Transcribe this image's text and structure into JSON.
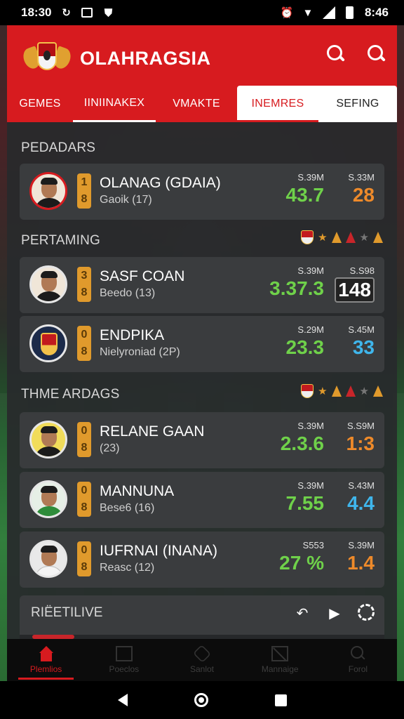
{
  "status_bar": {
    "time_left": "18:30",
    "time_right": "8:46"
  },
  "header": {
    "title": "OLAHRAGSIA",
    "icons": [
      "search-icon",
      "search-icon"
    ]
  },
  "tabs": [
    {
      "label": "GEMES"
    },
    {
      "label": "IINIINAKEX"
    },
    {
      "label": "VMAKTE"
    },
    {
      "label": "INEMRES"
    },
    {
      "label": "SEFING"
    }
  ],
  "sections": [
    {
      "title": "PEDADARS",
      "players": [
        {
          "name": "OLANAG (GDAIA)",
          "sub": "Gaoik (17)",
          "rank_top": "1",
          "rank_bottom": "8",
          "stat1_label": "S.39M",
          "stat1_value": "43.7",
          "stat2_label": "S.33M",
          "stat2_value": "28"
        }
      ]
    },
    {
      "title": "PERTAMING",
      "players": [
        {
          "name": "SASF COAN",
          "sub": "Beedo (13)",
          "rank_top": "3",
          "rank_bottom": "8",
          "stat1_label": "S.39M",
          "stat1_value": "3.37.3",
          "stat2_label": "S.S98",
          "stat2_value": "148"
        },
        {
          "name": "ENDPIKA",
          "sub": "Nielyroniad (2P)",
          "rank_top": "0",
          "rank_bottom": "8",
          "stat1_label": "S.29M",
          "stat1_value": "23.3",
          "stat2_label": "S.45M",
          "stat2_value": "33"
        }
      ]
    },
    {
      "title": "THME ARDAGS",
      "players": [
        {
          "name": "RELANE GAAN",
          "sub": "(23)",
          "rank_top": "0",
          "rank_bottom": "8",
          "stat1_label": "S.39M",
          "stat1_value": "2.3.6",
          "stat2_label": "S.S9M",
          "stat2_value": "1:3"
        },
        {
          "name": "MANNUNA",
          "sub": "Bese6 (16)",
          "rank_top": "0",
          "rank_bottom": "8",
          "stat1_label": "S.39M",
          "stat1_value": "7.55",
          "stat2_label": "S.43M",
          "stat2_value": "4.4"
        },
        {
          "name": "IUFRNAI (INANA)",
          "sub": "Reasc (12)",
          "rank_top": "0",
          "rank_bottom": "8",
          "stat1_label": "S553",
          "stat1_value": "27 %",
          "stat2_label": "S.39M",
          "stat2_value": "1.4"
        }
      ]
    }
  ],
  "live": {
    "title": "RIËETILIVE"
  },
  "bottom_nav": [
    {
      "label": "Plemlios"
    },
    {
      "label": "Poeclos"
    },
    {
      "label": "Sanlot"
    },
    {
      "label": "Mannaige"
    },
    {
      "label": "Forol"
    }
  ]
}
